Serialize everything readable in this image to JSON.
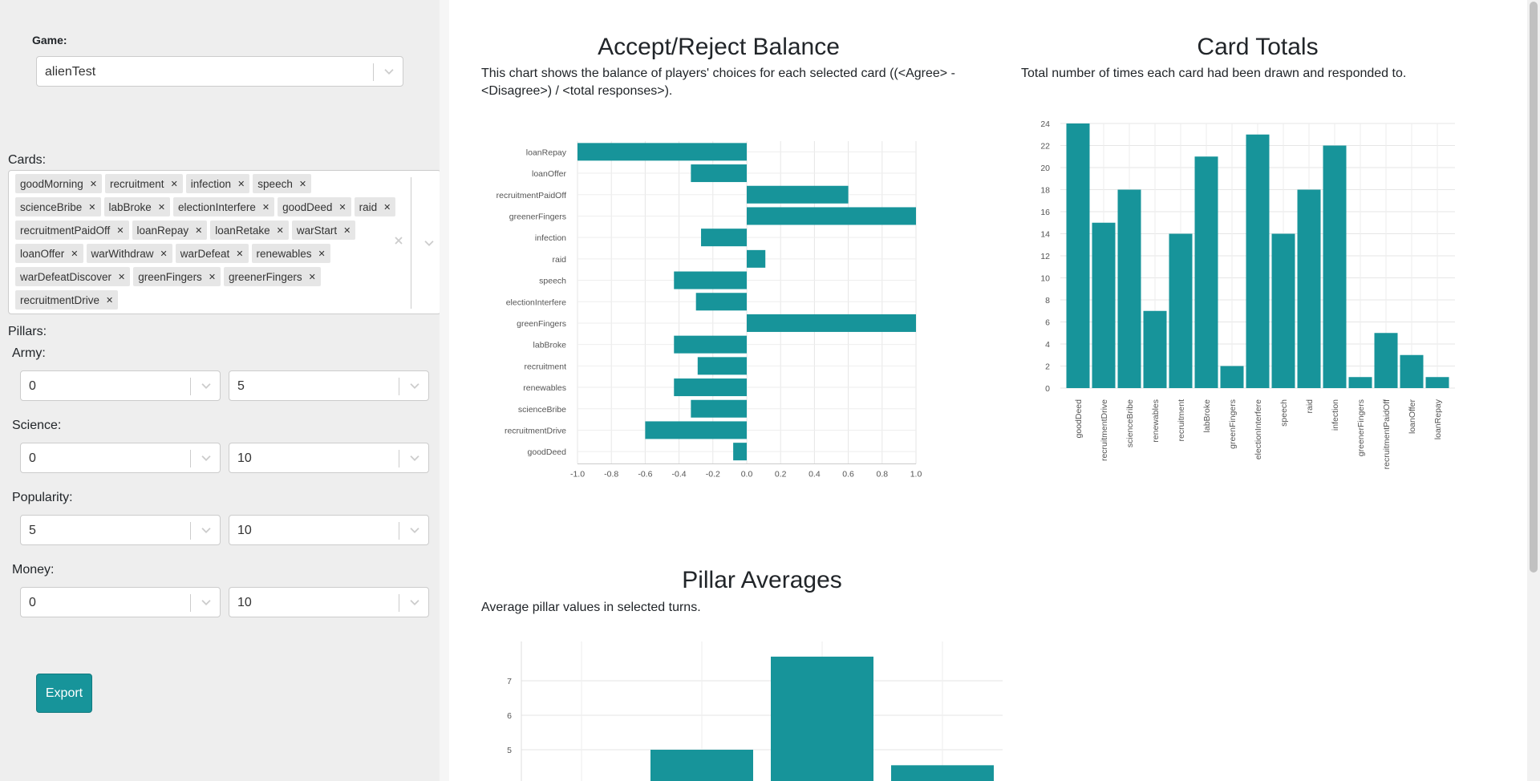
{
  "sidebar": {
    "game_label": "Game:",
    "game_value": "alienTest",
    "cards_label": "Cards:",
    "cards": [
      "goodMorning",
      "recruitment",
      "infection",
      "speech",
      "scienceBribe",
      "labBroke",
      "electionInterfere",
      "goodDeed",
      "raid",
      "recruitmentPaidOff",
      "loanRepay",
      "loanRetake",
      "warStart",
      "loanOffer",
      "warWithdraw",
      "warDefeat",
      "renewables",
      "warDefeatDiscover",
      "greenFingers",
      "greenerFingers",
      "recruitmentDrive"
    ],
    "pillars_label": "Pillars:",
    "pillars": [
      {
        "label": "Army:",
        "min": "0",
        "max": "5"
      },
      {
        "label": "Science:",
        "min": "0",
        "max": "10"
      },
      {
        "label": "Popularity:",
        "min": "5",
        "max": "10"
      },
      {
        "label": "Money:",
        "min": "0",
        "max": "10"
      }
    ],
    "export_label": "Export"
  },
  "charts": {
    "balance": {
      "title": "Accept/Reject Balance",
      "description": "This chart shows the balance of players' choices for each selected card ((<Agree> - <Disagree>) / <total responses>)."
    },
    "totals": {
      "title": "Card Totals",
      "description": "Total number of times each card had been drawn and responded to."
    },
    "pillars": {
      "title": "Pillar Averages",
      "description": "Average pillar values in selected turns."
    }
  },
  "chart_data": [
    {
      "type": "bar",
      "orientation": "horizontal",
      "title": "Accept/Reject Balance",
      "categories": [
        "loanRepay",
        "loanOffer",
        "recruitmentPaidOff",
        "greenerFingers",
        "infection",
        "raid",
        "speech",
        "electionInterfere",
        "greenFingers",
        "labBroke",
        "recruitment",
        "renewables",
        "scienceBribe",
        "recruitmentDrive",
        "goodDeed"
      ],
      "values": [
        -1.0,
        -0.33,
        0.6,
        1.0,
        -0.27,
        0.11,
        -0.43,
        -0.3,
        1.0,
        -0.43,
        -0.29,
        -0.43,
        -0.33,
        -0.6,
        -0.08
      ],
      "xlim": [
        -1.0,
        1.0
      ],
      "xticks": [
        "-1.0",
        "-0.8",
        "-0.6",
        "-0.4",
        "-0.2",
        "0.0",
        "0.2",
        "0.4",
        "0.6",
        "0.8",
        "1.0"
      ],
      "color": "#17949a",
      "grid": true
    },
    {
      "type": "bar",
      "title": "Card Totals",
      "categories": [
        "goodDeed",
        "recruitmentDrive",
        "scienceBribe",
        "renewables",
        "recruitment",
        "labBroke",
        "greenFingers",
        "electionInterfere",
        "speech",
        "raid",
        "infection",
        "greenerFingers",
        "recruitmentPaidOff",
        "loanOffer",
        "loanRepay"
      ],
      "values": [
        24,
        15,
        18,
        7,
        14,
        21,
        2,
        23,
        14,
        18,
        22,
        1,
        5,
        3,
        1
      ],
      "ylim": [
        0,
        24
      ],
      "yticks": [
        "0",
        "2",
        "4",
        "6",
        "8",
        "10",
        "12",
        "14",
        "16",
        "18",
        "20",
        "22",
        "24"
      ],
      "color": "#17949a",
      "grid": true
    },
    {
      "type": "bar",
      "title": "Pillar Averages",
      "categories": [
        "",
        "",
        "",
        ""
      ],
      "values": [
        null,
        5.0,
        7.7,
        4.55
      ],
      "visible_yticks": [
        "5",
        "6",
        "7"
      ],
      "color": "#17949a",
      "grid": true
    }
  ]
}
